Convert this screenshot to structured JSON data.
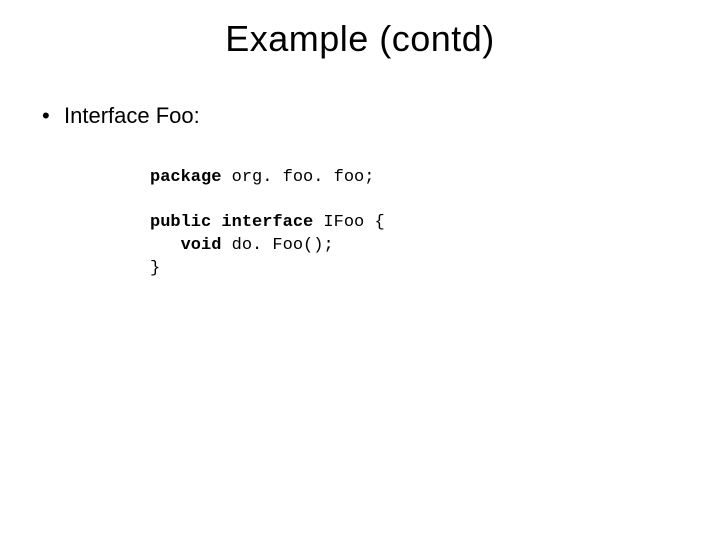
{
  "title": "Example (contd)",
  "bullet1": "Interface Foo:",
  "code": {
    "l1a": "package",
    "l1b": " org. foo. foo;",
    "l2a": "public interface",
    "l2b": " IFoo {",
    "l3a": "void",
    "l3b": " do. Foo();",
    "l4": "}"
  }
}
